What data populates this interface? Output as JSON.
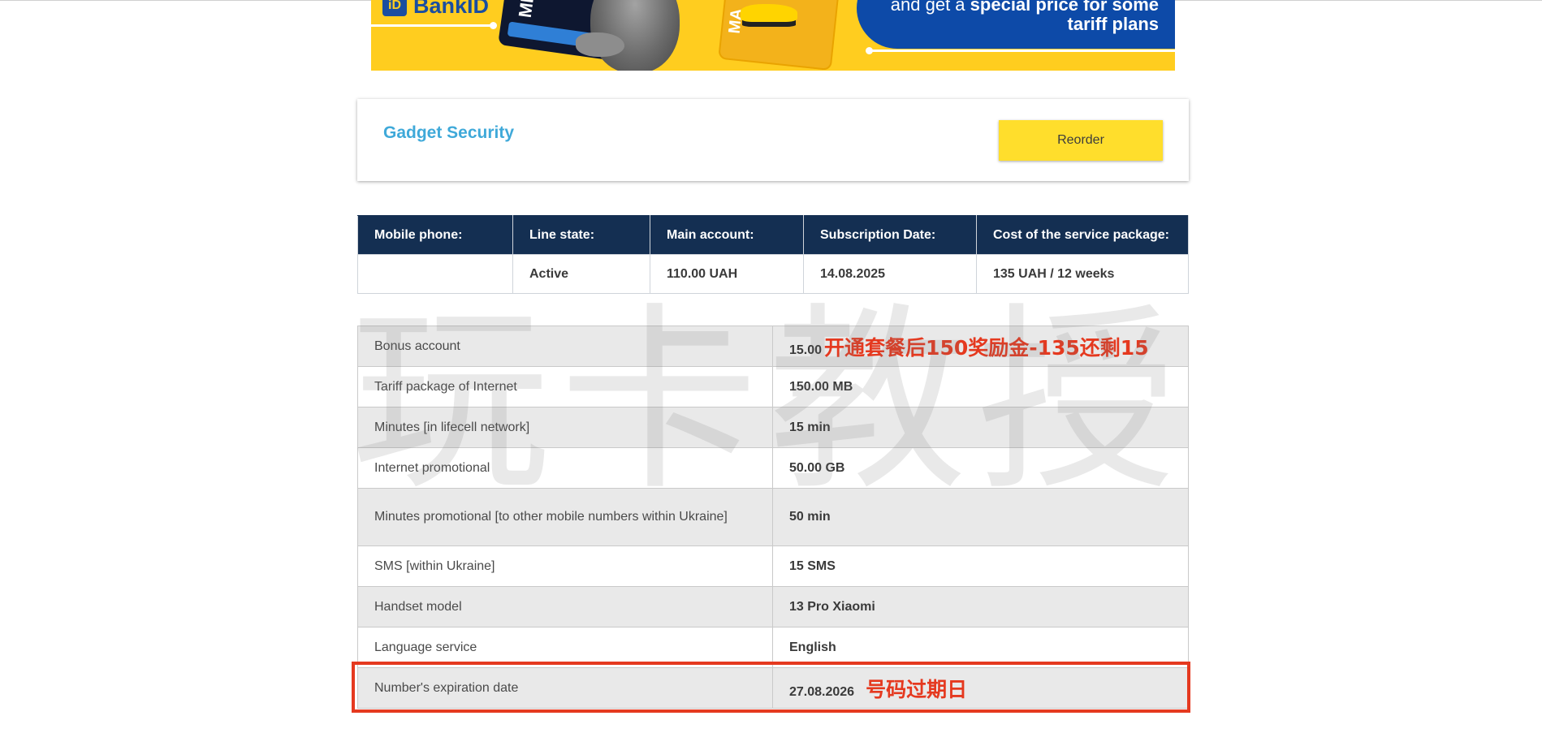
{
  "banner": {
    "logo_text": "BankID",
    "card_left_text": "ME",
    "card_right_text": "MA",
    "line1": "and get a",
    "line1_bold": "special price for some",
    "line2": "tariff plans"
  },
  "product": {
    "title": "Gadget Security",
    "reorder_label": "Reorder"
  },
  "summary": {
    "headers": [
      "Mobile phone:",
      "Line state:",
      "Main account:",
      "Subscription Date:",
      "Cost of the service package:"
    ],
    "values": [
      "",
      "Active",
      "110.00 UAH",
      "14.08.2025",
      "135 UAH / 12 weeks"
    ]
  },
  "details": {
    "rows": [
      {
        "label": "Bonus account",
        "value": "15.00"
      },
      {
        "label": "Tariff package of Internet",
        "value": "150.00 MB"
      },
      {
        "label": "Minutes [in lifecell network]",
        "value": "15 min"
      },
      {
        "label": "Internet promotional",
        "value": "50.00 GB"
      },
      {
        "label": "Minutes promotional [to other mobile numbers within Ukraine]",
        "value": "50 min"
      },
      {
        "label": "SMS [within Ukraine]",
        "value": "15 SMS"
      },
      {
        "label": "Handset model",
        "value": "13 Pro Xiaomi"
      },
      {
        "label": "Language service",
        "value": "English"
      },
      {
        "label": "Number's expiration date",
        "value": "27.08.2026"
      }
    ]
  },
  "annotations": {
    "bonus_note": "开通套餐后150奖励金-135还剩15",
    "expiry_note": "号码过期日",
    "watermark": "玩卡教授"
  },
  "colors": {
    "header_bg": "#142f52",
    "title": "#3fa9d9",
    "reorder_bg": "#ffde2c",
    "annotation": "#e5391f",
    "banner_yellow": "#ffcd1f",
    "banner_blue": "#0d4aa8"
  }
}
